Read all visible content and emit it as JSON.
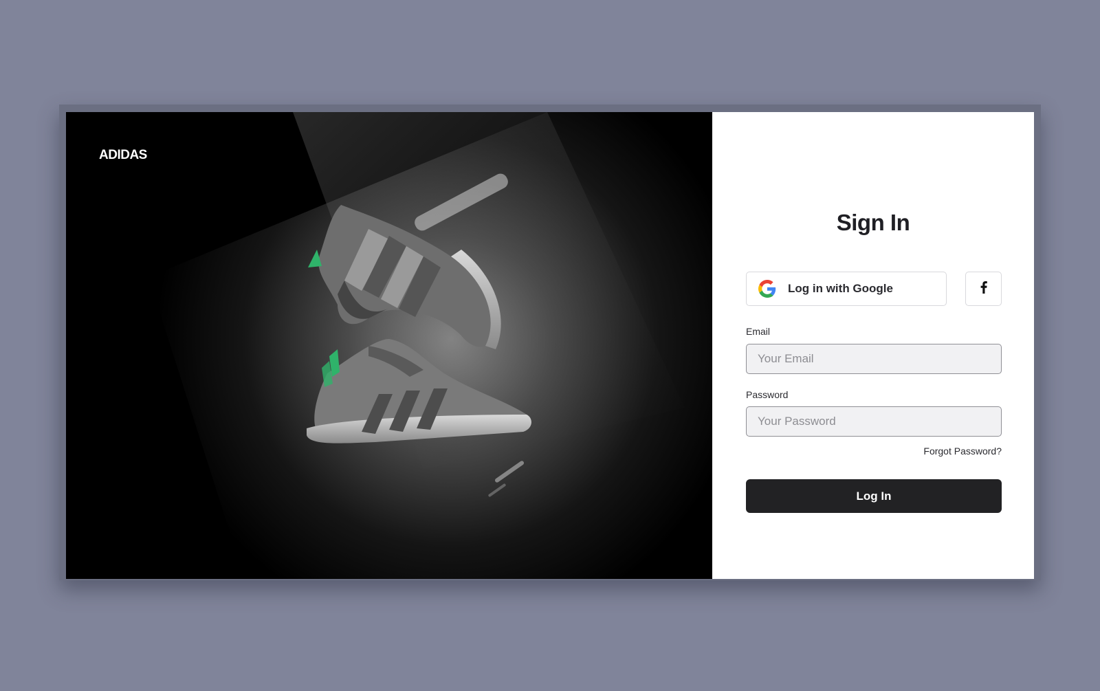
{
  "brand": {
    "name": "ADIDAS"
  },
  "hero": {
    "image_icon": "sneakers-photo"
  },
  "form": {
    "title": "Sign In",
    "google_label": "Log in with Google",
    "google_icon": "google-icon",
    "facebook_icon": "facebook-icon",
    "email_label": "Email",
    "email_placeholder": "Your Email",
    "email_value": "",
    "password_label": "Password",
    "password_placeholder": "Your Password",
    "password_value": "",
    "forgot_label": "Forgot Password?",
    "submit_label": "Log In"
  },
  "colors": {
    "page_background": "#80849a",
    "hero_background": "#000000",
    "panel_background": "#ffffff",
    "primary_button": "#222224",
    "accent_green": "#2fb36a"
  }
}
